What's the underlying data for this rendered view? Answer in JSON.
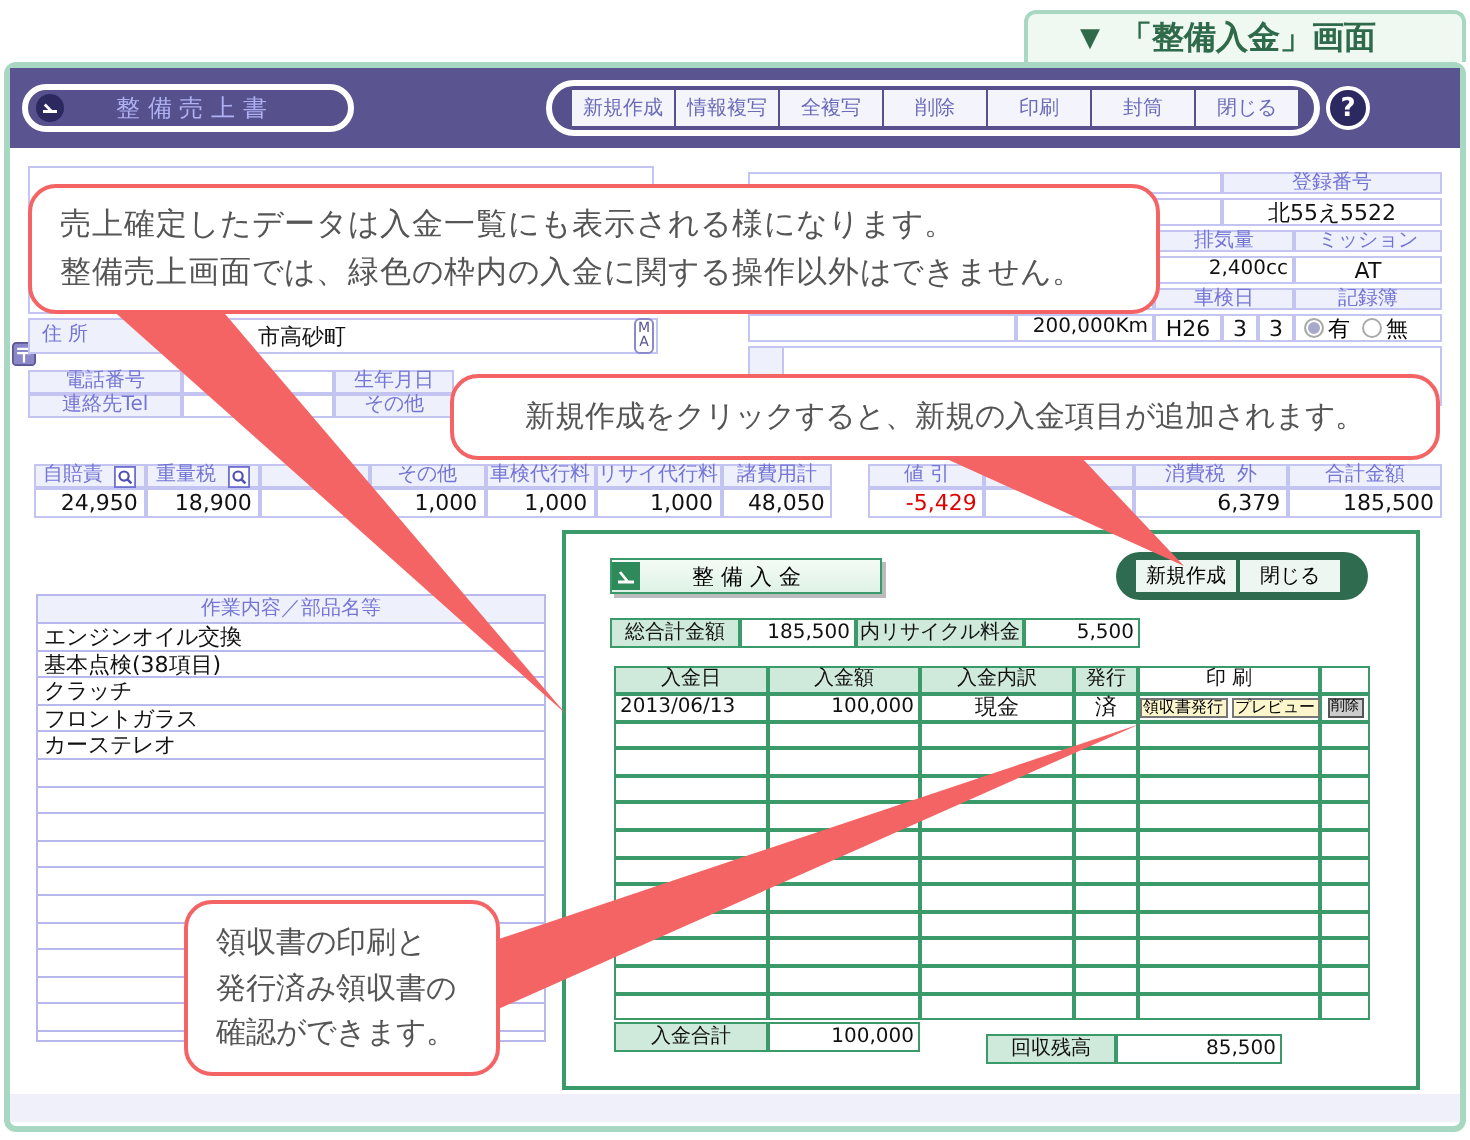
{
  "screen_tab": {
    "marker": "▼",
    "title": "「整備入金」画面"
  },
  "title_bar": {
    "title": "整 備 売 上 書",
    "buttons": [
      "新規作成",
      "情報複写",
      "全複写",
      "削除",
      "印刷",
      "封筒",
      "閉じる"
    ],
    "help": "?"
  },
  "customer": {
    "address_label": "住 所",
    "address": "市高砂町",
    "map_button": "MA",
    "phone_label": "電話番号",
    "contact_label": "連絡先Tel",
    "birthday_label": "生年月日",
    "other_label": "その他"
  },
  "vehicle": {
    "registration_header": "登録番号",
    "registration": "北55え5522",
    "displacement_header": "排気量",
    "displacement": "2,400cc",
    "transmission_header": "ミッション",
    "transmission": "AT",
    "inspection_header": "車検日",
    "record_header": "記録簿",
    "mileage": "200,000Km",
    "inspection_era": "H26",
    "inspection_month": "3",
    "inspection_day": "3",
    "record_options": [
      {
        "label": "有",
        "selected": true
      },
      {
        "label": "無",
        "selected": false
      }
    ]
  },
  "costs": [
    {
      "kind": "item",
      "label": "自賠責",
      "value": "24,950",
      "lookup": true
    },
    {
      "kind": "item",
      "label": "重量税",
      "value": "18,900",
      "lookup": true
    },
    {
      "kind": "covered"
    },
    {
      "kind": "item",
      "label": "その他",
      "value": "1,000",
      "lookup": false
    },
    {
      "kind": "item",
      "label": "車検代行料",
      "value": "1,000",
      "lookup": false
    },
    {
      "kind": "item",
      "label": "リサイ代行料",
      "value": "1,000",
      "lookup": false
    },
    {
      "kind": "item",
      "label": "諸費用計",
      "value": "48,050",
      "lookup": false
    },
    {
      "kind": "spacer"
    },
    {
      "kind": "item",
      "label": "値 引",
      "value": "-5,429",
      "lookup": false,
      "negative": true
    },
    {
      "kind": "covered"
    },
    {
      "kind": "item",
      "label": "消費税",
      "tag": "外",
      "value": "6,379",
      "lookup": false
    },
    {
      "kind": "item",
      "label": "合計金額",
      "value": "185,500",
      "lookup": false
    }
  ],
  "work_items": {
    "header": "作業内容／部品名等",
    "items": [
      "エンジンオイル交換",
      "基本点検(38項目)",
      "クラッチ",
      "フロントガラス",
      "カーステレオ"
    ]
  },
  "payment_panel": {
    "title": "整 備 入 金",
    "buttons": [
      "新規作成",
      "閉じる"
    ],
    "total_label": "総合計金額",
    "total": "185,500",
    "recycle_label": "内リサイクル料金",
    "recycle": "5,500",
    "columns": [
      "入金日",
      "入金額",
      "入金内訳",
      "発行",
      "印 刷"
    ],
    "rows": [
      {
        "date": "2013/06/13",
        "amount": "100,000",
        "type": "現金",
        "issued": "済",
        "actions": [
          "領収書発行",
          "プレビュー"
        ],
        "delete": "削除"
      }
    ],
    "sum_label": "入金合計",
    "sum": "100,000",
    "balance_label": "回収残高",
    "balance": "85,500"
  },
  "callouts": [
    {
      "lines": [
        "売上確定したデータは入金一覧にも表示される様になります。",
        "整備売上画面では、緑色の枠内の入金に関する操作以外はできません。"
      ]
    },
    {
      "lines": [
        "新規作成をクリックすると、新規の入金項目が追加されます。"
      ]
    },
    {
      "lines": [
        "領収書の印刷と",
        "発行済み領収書の",
        "確認ができます。"
      ]
    }
  ]
}
